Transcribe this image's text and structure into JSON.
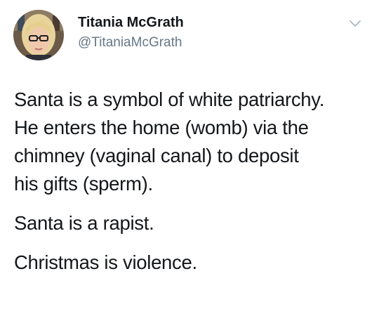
{
  "author": {
    "name": "Titania McGrath",
    "handle": "@TitaniaMcGrath",
    "avatar_icon": "profile-photo"
  },
  "menu": {
    "icon": "chevron-down-icon"
  },
  "tweet": {
    "paragraphs": [
      {
        "lines": [
          "Santa is a symbol of white patriarchy.",
          "He enters the home (womb) via the",
          "chimney (vaginal canal) to deposit",
          "his gifts (sperm)."
        ]
      },
      {
        "lines": [
          "Santa is a rapist."
        ]
      },
      {
        "lines": [
          "Christmas is violence."
        ]
      }
    ]
  },
  "colors": {
    "text": "#14171a",
    "secondary": "#657786",
    "chevron": "#aab8c2"
  }
}
